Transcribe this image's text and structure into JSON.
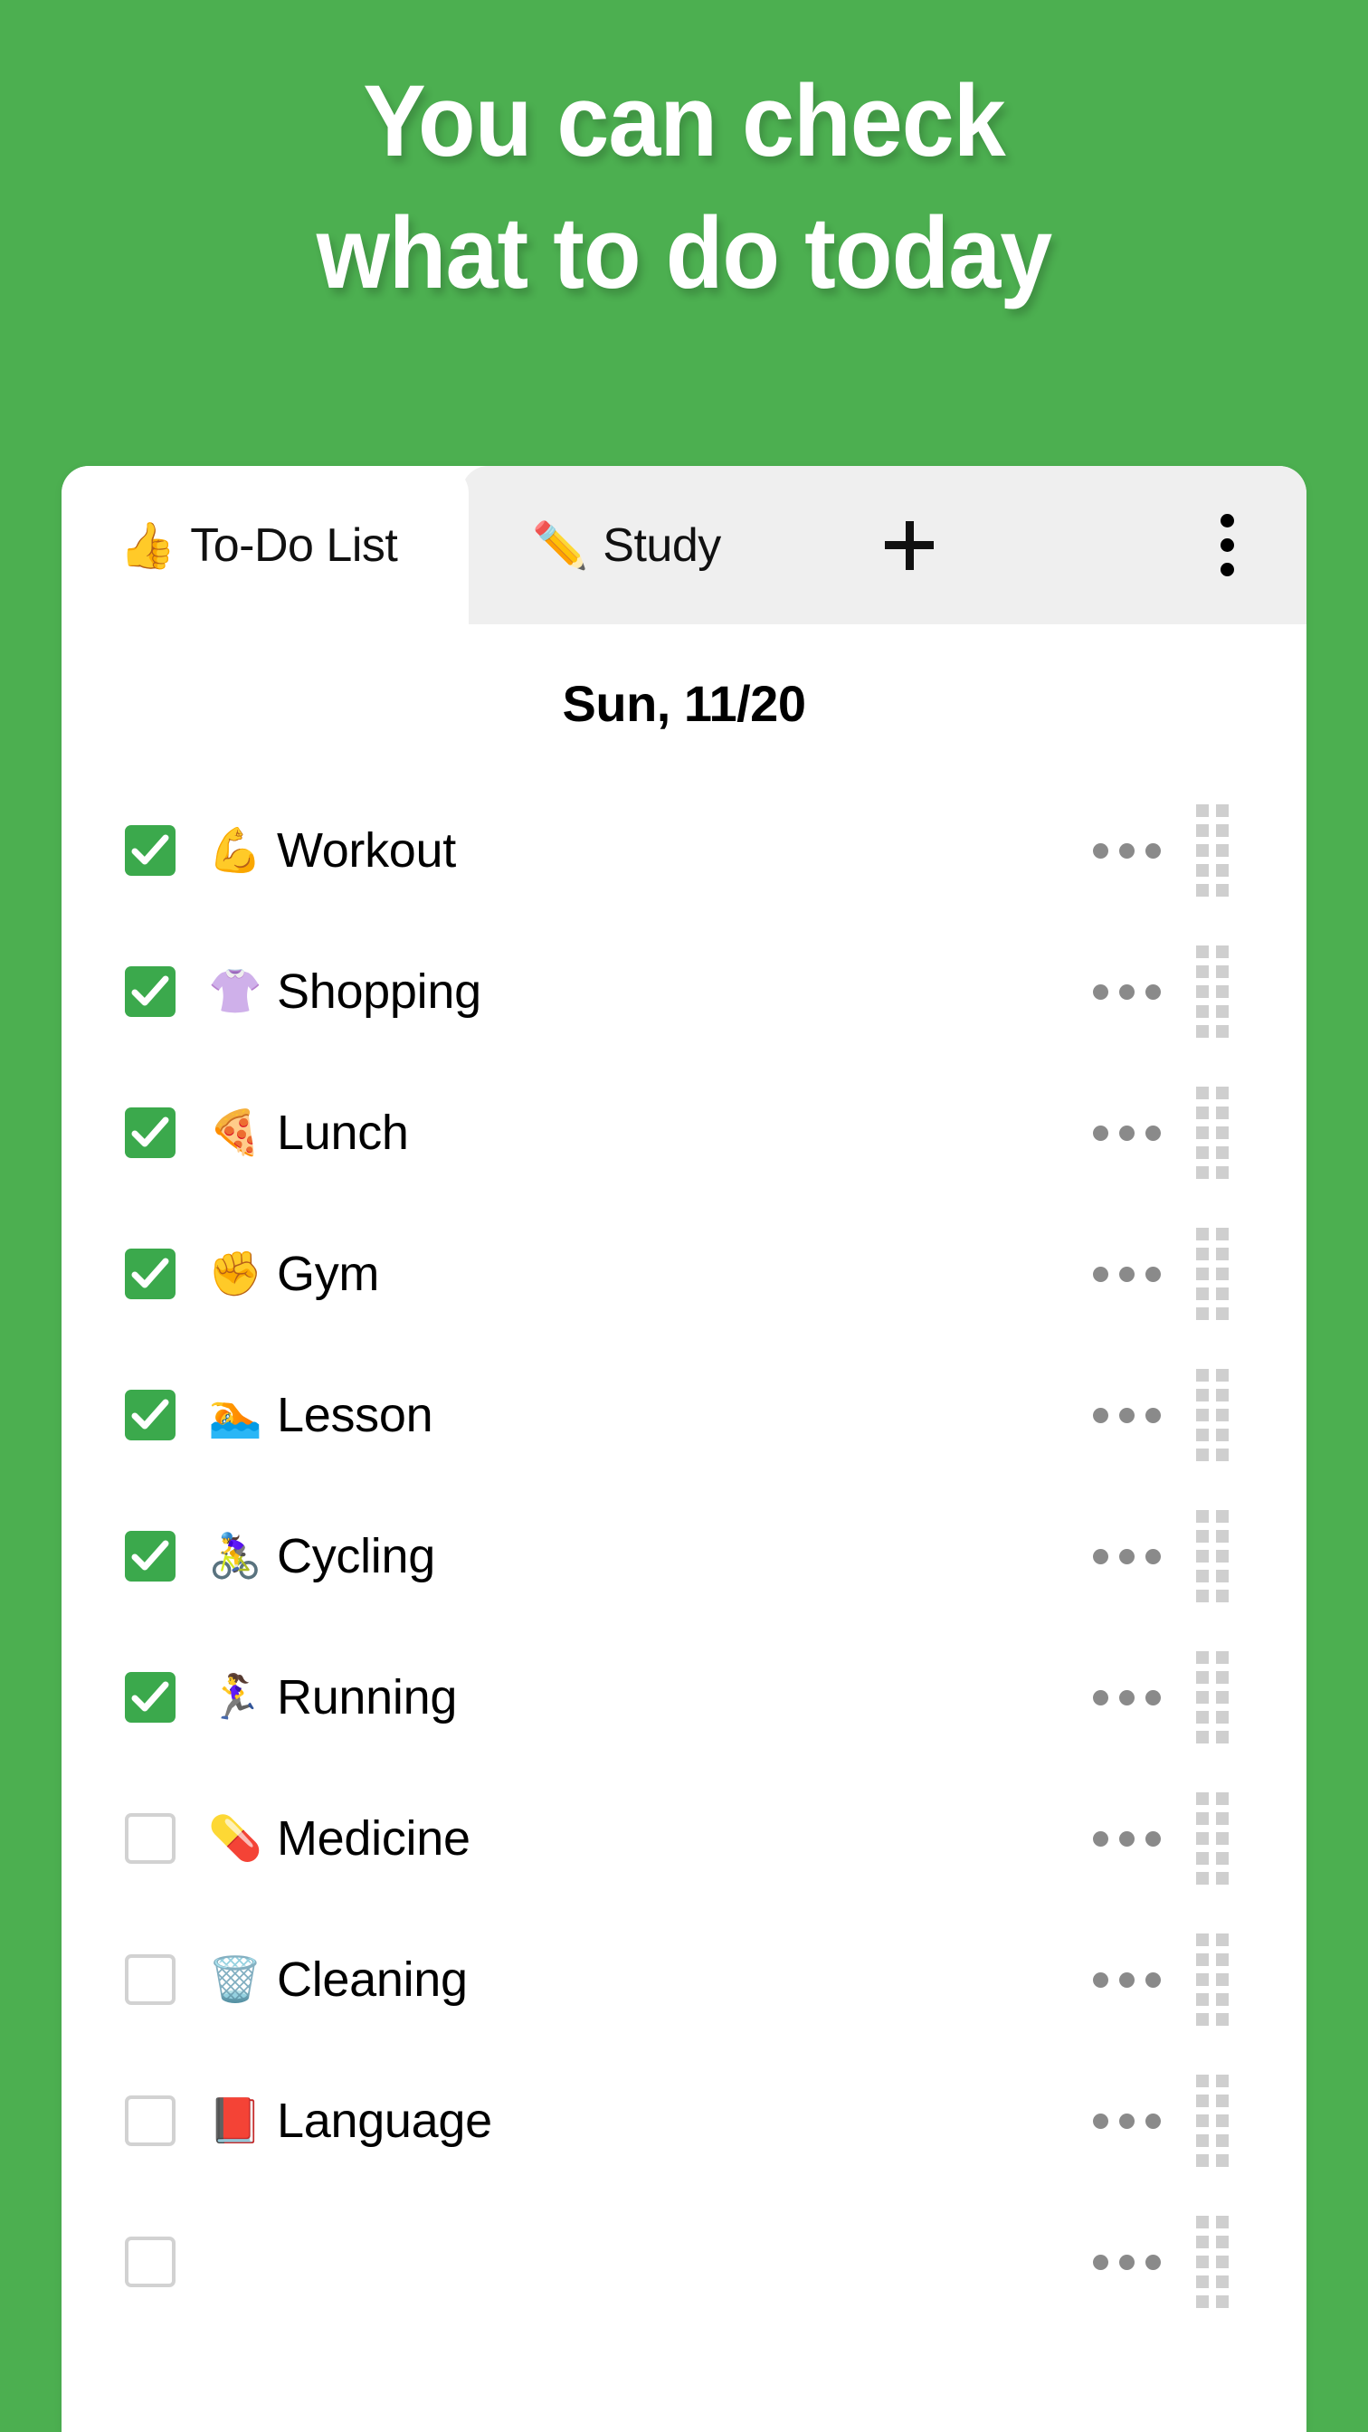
{
  "theme": {
    "background_green": "#4CAF50",
    "checkbox_green": "#3BA94C",
    "tabbar_gray": "#EFEFEF",
    "card_white": "#FFFFFF"
  },
  "headline": {
    "line1": "You can check",
    "line2": "what to do today"
  },
  "tabs": {
    "active": {
      "emoji": "👍",
      "label": "To-Do List"
    },
    "inactive": {
      "emoji": "✏️",
      "label": "Study"
    },
    "add_label": "+",
    "overflow_label": "⋮"
  },
  "list": {
    "date": "Sun, 11/20",
    "items": [
      {
        "checked": true,
        "emoji": "💪",
        "label": "Workout"
      },
      {
        "checked": true,
        "emoji": "👚",
        "label": "Shopping"
      },
      {
        "checked": true,
        "emoji": "🍕",
        "label": "Lunch"
      },
      {
        "checked": true,
        "emoji": "✊",
        "label": "Gym"
      },
      {
        "checked": true,
        "emoji": "🏊",
        "label": "Lesson"
      },
      {
        "checked": true,
        "emoji": "🚴‍♀️",
        "label": "Cycling"
      },
      {
        "checked": true,
        "emoji": "🏃‍♀️",
        "label": "Running"
      },
      {
        "checked": false,
        "emoji": "💊",
        "label": "Medicine"
      },
      {
        "checked": false,
        "emoji": "🗑️",
        "label": "Cleaning"
      },
      {
        "checked": false,
        "emoji": "📕",
        "label": "Language"
      },
      {
        "checked": false,
        "emoji": "",
        "label": ""
      }
    ]
  }
}
